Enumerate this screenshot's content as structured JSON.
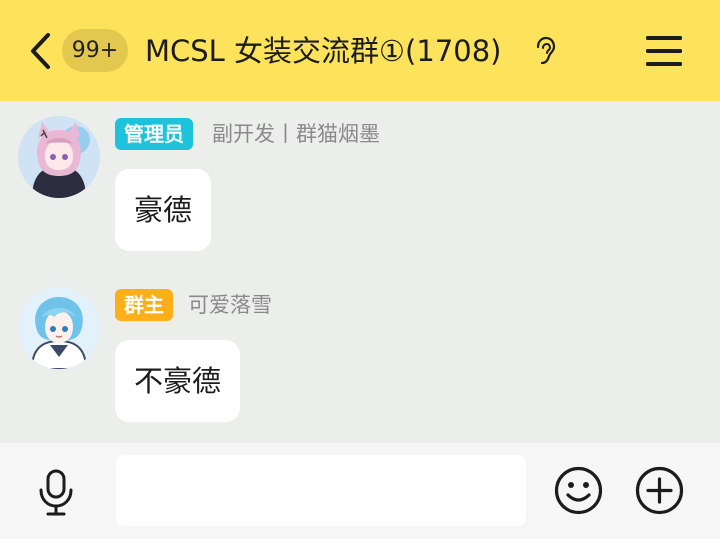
{
  "header": {
    "unread_count": "99+",
    "title": "MCSL 女装交流群①(1708)",
    "icons": {
      "back": "chevron-left",
      "mode": "ear",
      "menu": "hamburger"
    },
    "background_color": "#fde35b"
  },
  "messages": [
    {
      "role_badge": "管理员",
      "role_color": "#1cc3da",
      "sender": "副开发丨群猫烟墨",
      "text": "豪德",
      "avatar": "anime-girl-avatar"
    },
    {
      "role_badge": "群主",
      "role_color": "#fbb019",
      "sender": "可爱落雪",
      "text": "不豪德",
      "avatar": "anime-boy-avatar"
    }
  ],
  "input_bar": {
    "placeholder": "",
    "icons": {
      "voice": "microphone",
      "emoji": "smiley",
      "more": "plus-circle"
    }
  }
}
